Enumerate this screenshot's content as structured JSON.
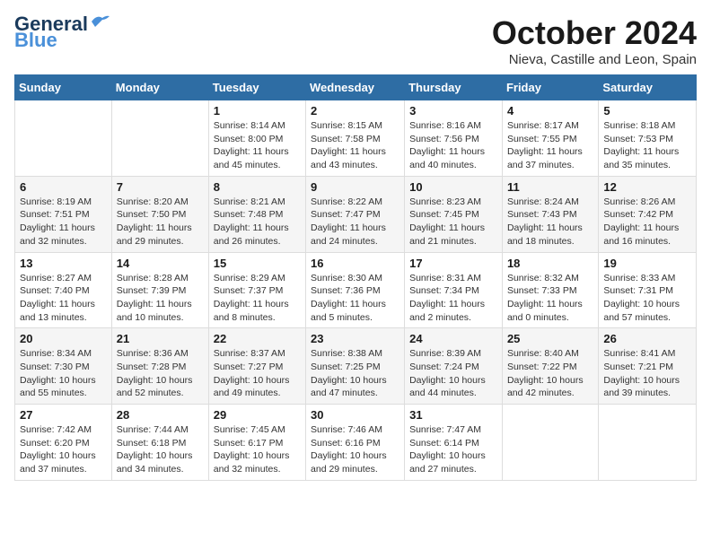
{
  "header": {
    "logo_line1": "General",
    "logo_line2": "Blue",
    "month": "October 2024",
    "location": "Nieva, Castille and Leon, Spain"
  },
  "days_of_week": [
    "Sunday",
    "Monday",
    "Tuesday",
    "Wednesday",
    "Thursday",
    "Friday",
    "Saturday"
  ],
  "weeks": [
    [
      {
        "num": "",
        "info": ""
      },
      {
        "num": "",
        "info": ""
      },
      {
        "num": "1",
        "info": "Sunrise: 8:14 AM\nSunset: 8:00 PM\nDaylight: 11 hours\nand 45 minutes."
      },
      {
        "num": "2",
        "info": "Sunrise: 8:15 AM\nSunset: 7:58 PM\nDaylight: 11 hours\nand 43 minutes."
      },
      {
        "num": "3",
        "info": "Sunrise: 8:16 AM\nSunset: 7:56 PM\nDaylight: 11 hours\nand 40 minutes."
      },
      {
        "num": "4",
        "info": "Sunrise: 8:17 AM\nSunset: 7:55 PM\nDaylight: 11 hours\nand 37 minutes."
      },
      {
        "num": "5",
        "info": "Sunrise: 8:18 AM\nSunset: 7:53 PM\nDaylight: 11 hours\nand 35 minutes."
      }
    ],
    [
      {
        "num": "6",
        "info": "Sunrise: 8:19 AM\nSunset: 7:51 PM\nDaylight: 11 hours\nand 32 minutes."
      },
      {
        "num": "7",
        "info": "Sunrise: 8:20 AM\nSunset: 7:50 PM\nDaylight: 11 hours\nand 29 minutes."
      },
      {
        "num": "8",
        "info": "Sunrise: 8:21 AM\nSunset: 7:48 PM\nDaylight: 11 hours\nand 26 minutes."
      },
      {
        "num": "9",
        "info": "Sunrise: 8:22 AM\nSunset: 7:47 PM\nDaylight: 11 hours\nand 24 minutes."
      },
      {
        "num": "10",
        "info": "Sunrise: 8:23 AM\nSunset: 7:45 PM\nDaylight: 11 hours\nand 21 minutes."
      },
      {
        "num": "11",
        "info": "Sunrise: 8:24 AM\nSunset: 7:43 PM\nDaylight: 11 hours\nand 18 minutes."
      },
      {
        "num": "12",
        "info": "Sunrise: 8:26 AM\nSunset: 7:42 PM\nDaylight: 11 hours\nand 16 minutes."
      }
    ],
    [
      {
        "num": "13",
        "info": "Sunrise: 8:27 AM\nSunset: 7:40 PM\nDaylight: 11 hours\nand 13 minutes."
      },
      {
        "num": "14",
        "info": "Sunrise: 8:28 AM\nSunset: 7:39 PM\nDaylight: 11 hours\nand 10 minutes."
      },
      {
        "num": "15",
        "info": "Sunrise: 8:29 AM\nSunset: 7:37 PM\nDaylight: 11 hours\nand 8 minutes."
      },
      {
        "num": "16",
        "info": "Sunrise: 8:30 AM\nSunset: 7:36 PM\nDaylight: 11 hours\nand 5 minutes."
      },
      {
        "num": "17",
        "info": "Sunrise: 8:31 AM\nSunset: 7:34 PM\nDaylight: 11 hours\nand 2 minutes."
      },
      {
        "num": "18",
        "info": "Sunrise: 8:32 AM\nSunset: 7:33 PM\nDaylight: 11 hours\nand 0 minutes."
      },
      {
        "num": "19",
        "info": "Sunrise: 8:33 AM\nSunset: 7:31 PM\nDaylight: 10 hours\nand 57 minutes."
      }
    ],
    [
      {
        "num": "20",
        "info": "Sunrise: 8:34 AM\nSunset: 7:30 PM\nDaylight: 10 hours\nand 55 minutes."
      },
      {
        "num": "21",
        "info": "Sunrise: 8:36 AM\nSunset: 7:28 PM\nDaylight: 10 hours\nand 52 minutes."
      },
      {
        "num": "22",
        "info": "Sunrise: 8:37 AM\nSunset: 7:27 PM\nDaylight: 10 hours\nand 49 minutes."
      },
      {
        "num": "23",
        "info": "Sunrise: 8:38 AM\nSunset: 7:25 PM\nDaylight: 10 hours\nand 47 minutes."
      },
      {
        "num": "24",
        "info": "Sunrise: 8:39 AM\nSunset: 7:24 PM\nDaylight: 10 hours\nand 44 minutes."
      },
      {
        "num": "25",
        "info": "Sunrise: 8:40 AM\nSunset: 7:22 PM\nDaylight: 10 hours\nand 42 minutes."
      },
      {
        "num": "26",
        "info": "Sunrise: 8:41 AM\nSunset: 7:21 PM\nDaylight: 10 hours\nand 39 minutes."
      }
    ],
    [
      {
        "num": "27",
        "info": "Sunrise: 7:42 AM\nSunset: 6:20 PM\nDaylight: 10 hours\nand 37 minutes."
      },
      {
        "num": "28",
        "info": "Sunrise: 7:44 AM\nSunset: 6:18 PM\nDaylight: 10 hours\nand 34 minutes."
      },
      {
        "num": "29",
        "info": "Sunrise: 7:45 AM\nSunset: 6:17 PM\nDaylight: 10 hours\nand 32 minutes."
      },
      {
        "num": "30",
        "info": "Sunrise: 7:46 AM\nSunset: 6:16 PM\nDaylight: 10 hours\nand 29 minutes."
      },
      {
        "num": "31",
        "info": "Sunrise: 7:47 AM\nSunset: 6:14 PM\nDaylight: 10 hours\nand 27 minutes."
      },
      {
        "num": "",
        "info": ""
      },
      {
        "num": "",
        "info": ""
      }
    ]
  ]
}
